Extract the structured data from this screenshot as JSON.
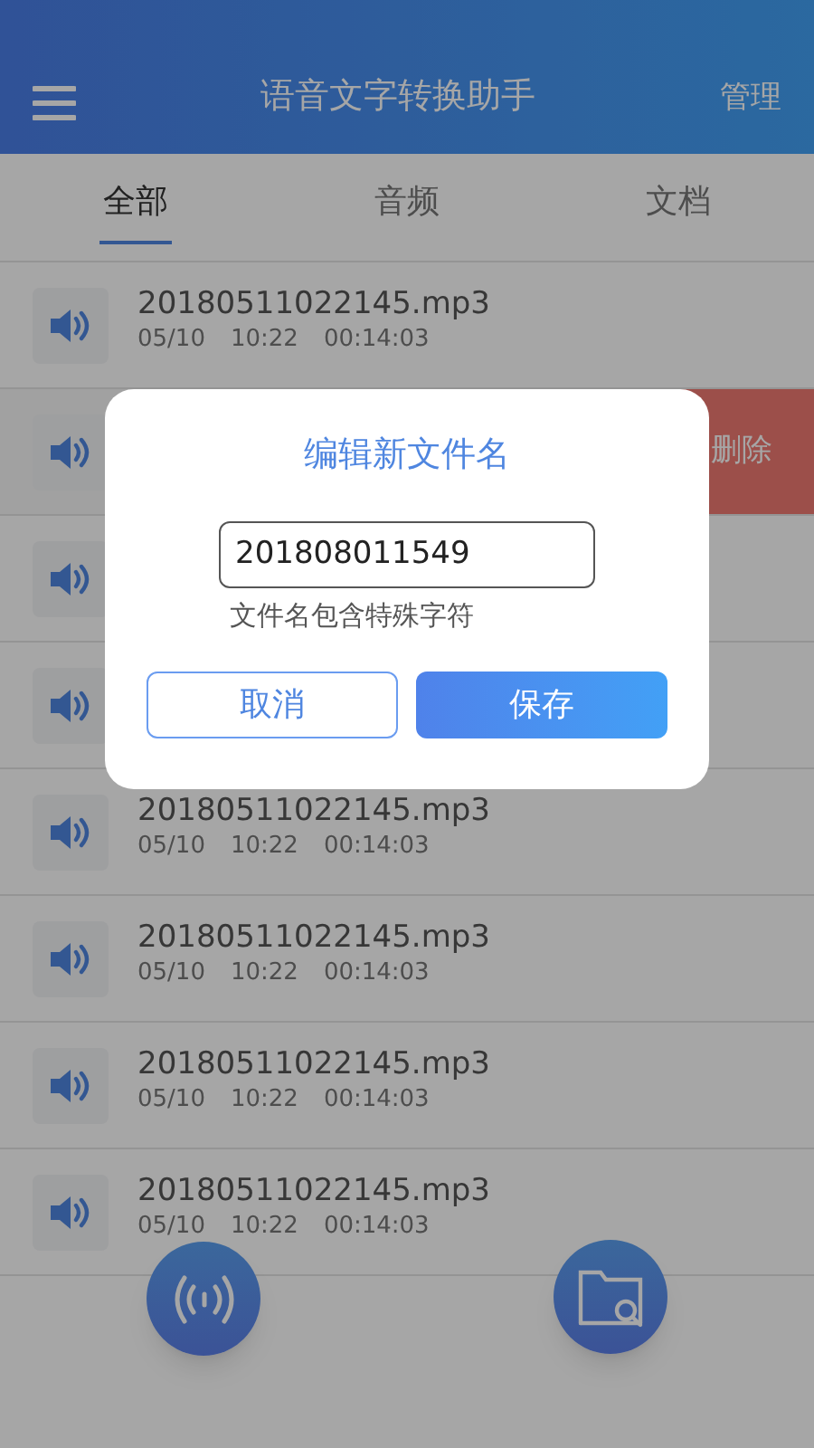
{
  "header": {
    "title": "语音文字转换助手",
    "action": "管理"
  },
  "tabs": [
    {
      "label": "全部",
      "selected": true
    },
    {
      "label": "音频",
      "selected": false
    },
    {
      "label": "文档",
      "selected": false
    }
  ],
  "files": [
    {
      "name": "20180511022145.mp3",
      "date": "05/10",
      "time": "10:22",
      "duration": "00:14:03",
      "swiped": false
    },
    {
      "swiped": true,
      "delete_label": "删除"
    },
    {
      "swiped": false
    },
    {
      "swiped": false
    },
    {
      "name": "20180511022145.mp3",
      "date": "05/10",
      "time": "10:22",
      "duration": "00:14:03",
      "swiped": false
    },
    {
      "name": "20180511022145.mp3",
      "date": "05/10",
      "time": "10:22",
      "duration": "00:14:03",
      "swiped": false
    },
    {
      "name": "20180511022145.mp3",
      "date": "05/10",
      "time": "10:22",
      "duration": "00:14:03",
      "swiped": false
    },
    {
      "name": "20180511022145.mp3",
      "date": "05/10",
      "time": "10:22",
      "duration": "00:14:03",
      "swiped": false
    }
  ],
  "dialog": {
    "title": "编辑新文件名",
    "value": "201808011549",
    "error": "文件名包含特殊字符",
    "cancel": "取消",
    "save": "保存"
  }
}
